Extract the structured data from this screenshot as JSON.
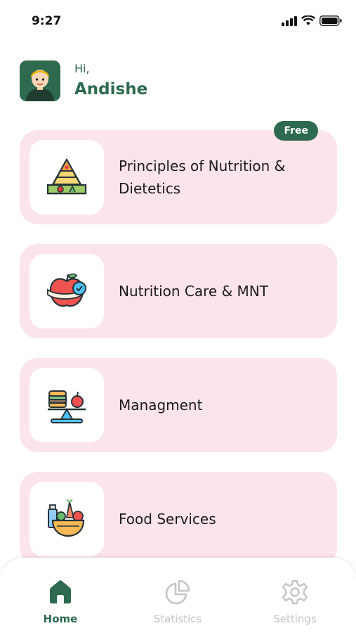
{
  "status_bar": {
    "time": "9:27",
    "icons": [
      "signal-icon",
      "wifi-icon",
      "battery-icon"
    ]
  },
  "greeting": {
    "hi": "Hi,",
    "name": "Andishe",
    "avatar_icon": "avatar-icon"
  },
  "courses": [
    {
      "title": "Principles of Nutrition & Dietetics",
      "badge": "Free",
      "icon": "food-pyramid-icon"
    },
    {
      "title": "Nutrition Care & MNT",
      "icon": "apple-measure-icon"
    },
    {
      "title": "Managment",
      "icon": "food-scale-icon"
    },
    {
      "title": "Food Services",
      "icon": "food-bowl-icon"
    }
  ],
  "tab_bar": {
    "tabs": [
      {
        "label": "Home",
        "icon": "home-icon",
        "active": true
      },
      {
        "label": "Statistics",
        "icon": "pie-chart-icon",
        "active": false
      },
      {
        "label": "Settings",
        "icon": "gear-icon",
        "active": false
      }
    ]
  },
  "colors": {
    "accent": "#2d6a4f",
    "card_bg": "#fbe4ea",
    "inactive": "#c4c4c4"
  }
}
